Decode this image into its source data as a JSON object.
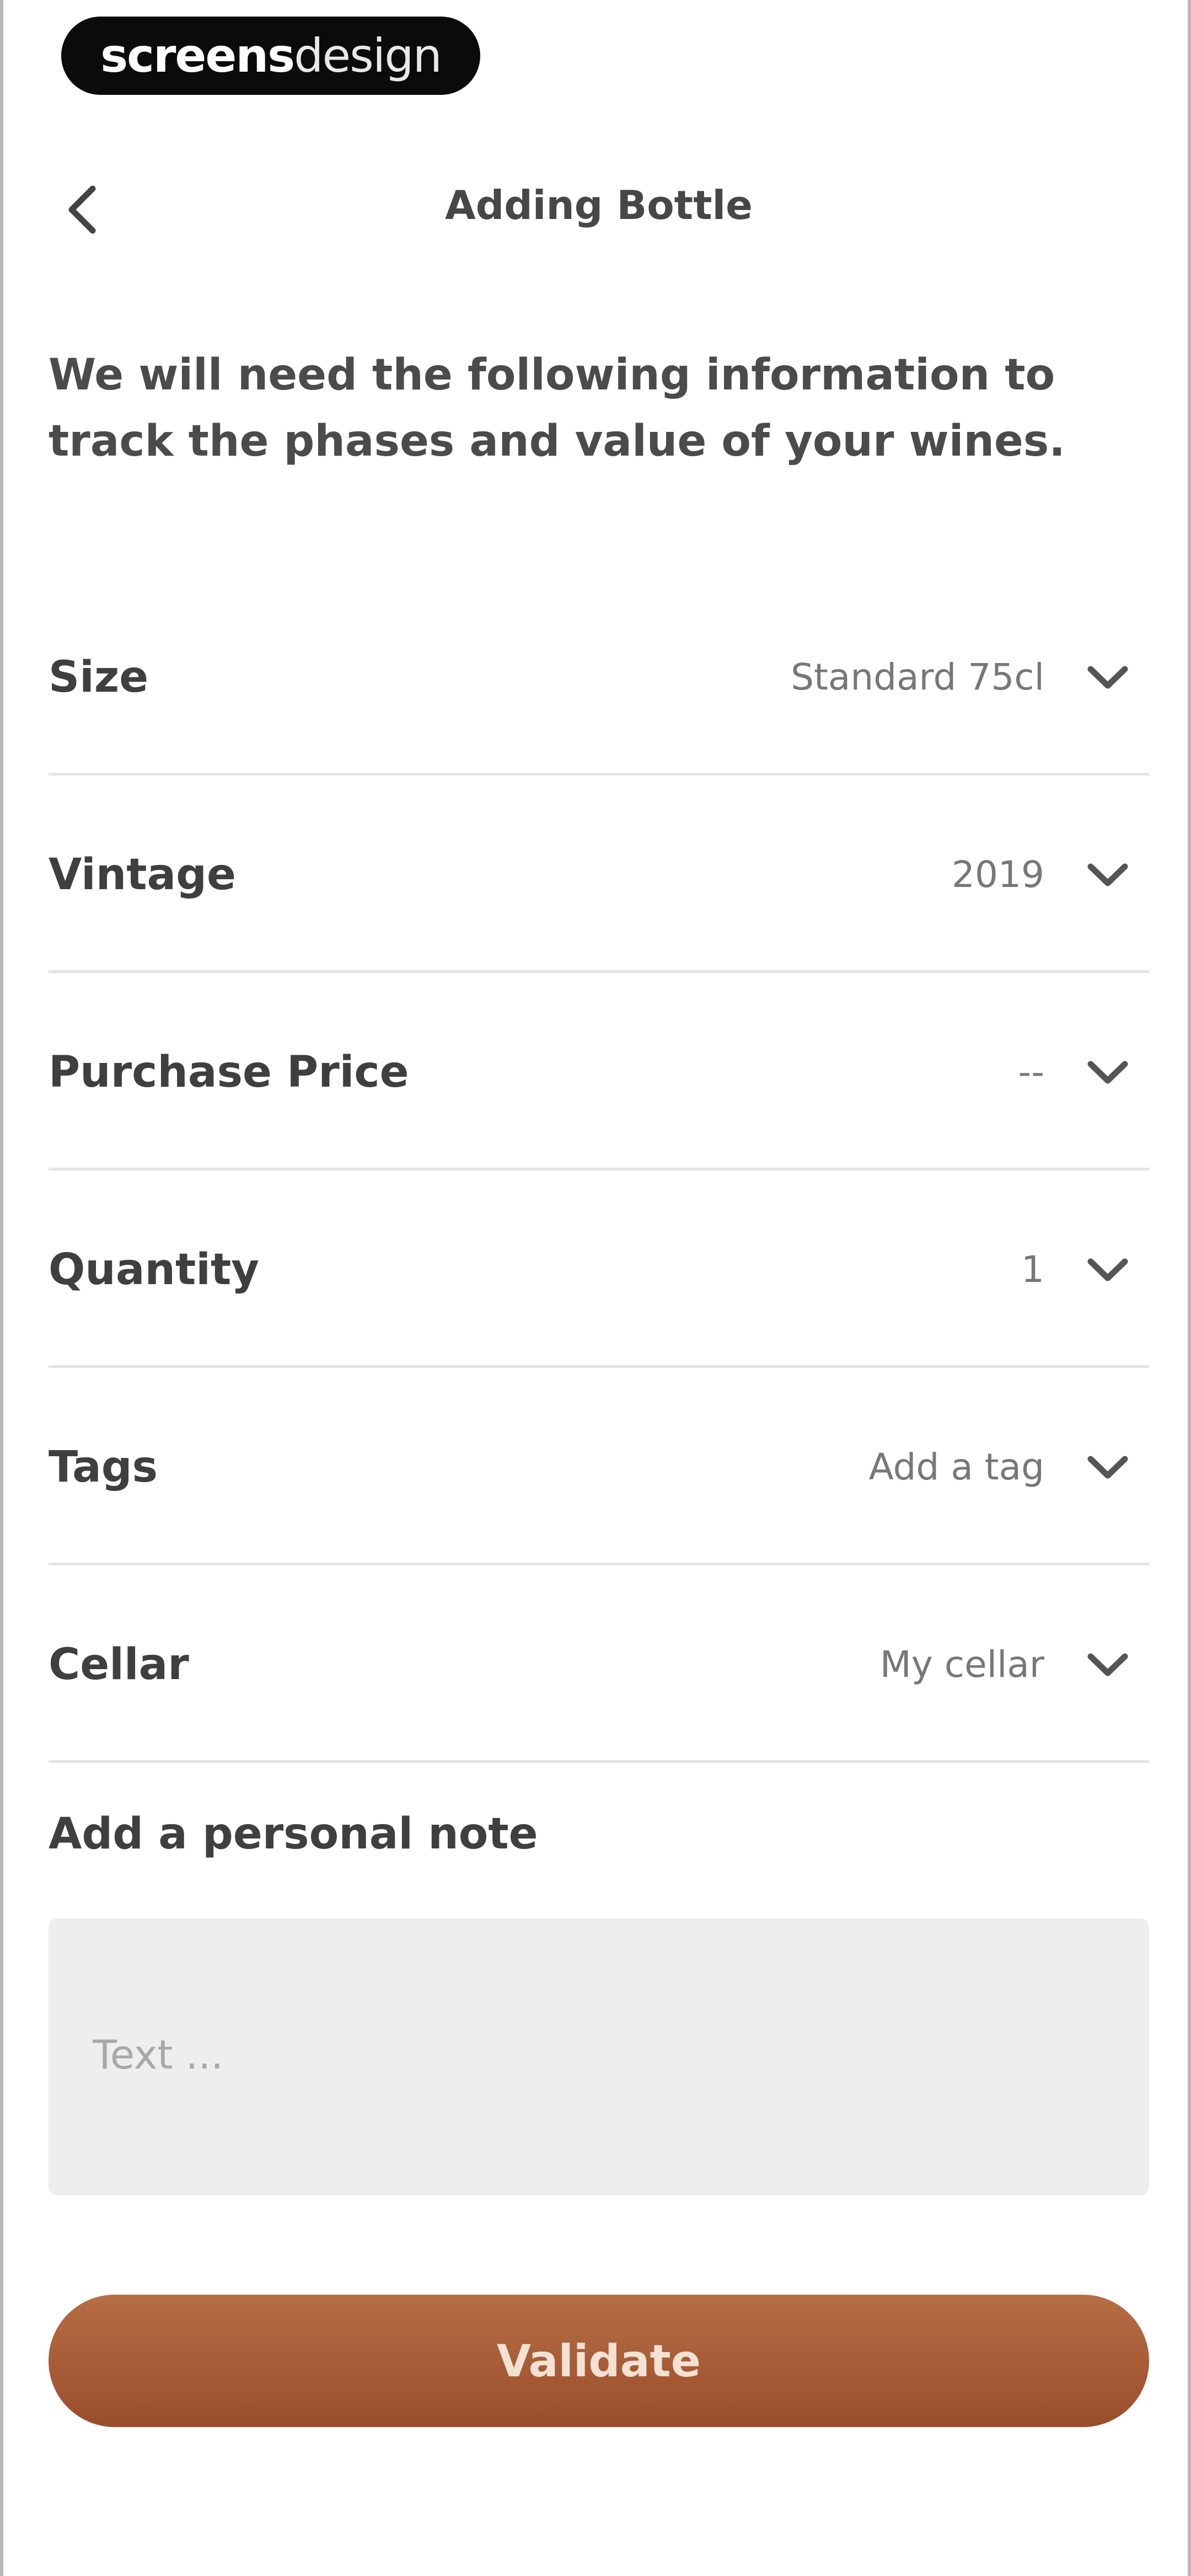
{
  "watermark": {
    "part1": "screens",
    "part2": "design"
  },
  "header": {
    "title": "Adding Bottle",
    "back_icon": "chevron-left-icon"
  },
  "intro": "We will need the following information to track the phases and value of your wines.",
  "fields": [
    {
      "label": "Size",
      "value": "Standard 75cl"
    },
    {
      "label": "Vintage",
      "value": "2019"
    },
    {
      "label": "Purchase Price",
      "value": "--"
    },
    {
      "label": "Quantity",
      "value": "1"
    },
    {
      "label": "Tags",
      "value": "Add a tag"
    },
    {
      "label": "Cellar",
      "value": "My cellar"
    }
  ],
  "note": {
    "label": "Add a personal note",
    "placeholder": "Text ..."
  },
  "validate_label": "Validate",
  "colors": {
    "accent": "#a85a33",
    "divider": "#e4e4e4",
    "note_bg": "#eeeeee"
  }
}
